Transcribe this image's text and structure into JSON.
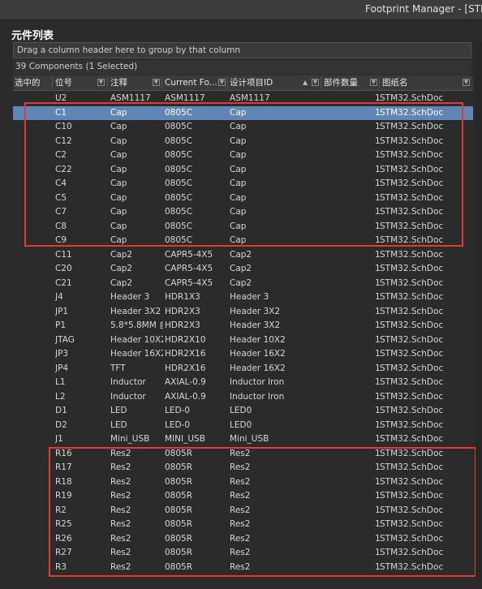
{
  "window": {
    "title": "Footprint Manager - [STM"
  },
  "panel": {
    "title": "元件列表"
  },
  "group_hint": "Drag a column header here to group by that column",
  "count_text": "39 Components (1 Selected)",
  "columns": [
    {
      "label": "选中的"
    },
    {
      "label": "位号"
    },
    {
      "label": "注释"
    },
    {
      "label": "Current Fo..."
    },
    {
      "label": "设计项目ID"
    },
    {
      "label": "部件数量"
    },
    {
      "label": "图纸名"
    }
  ],
  "rows": [
    {
      "designator": "U2",
      "comment": "ASM1117",
      "footprint": "ASM1117",
      "design_id": "ASM1117",
      "count": "1",
      "sheet": "STM32.SchDoc"
    },
    {
      "designator": "C1",
      "comment": "Cap",
      "footprint": "0805C",
      "design_id": "Cap",
      "count": "1",
      "sheet": "STM32.SchDoc"
    },
    {
      "designator": "C10",
      "comment": "Cap",
      "footprint": "0805C",
      "design_id": "Cap",
      "count": "1",
      "sheet": "STM32.SchDoc"
    },
    {
      "designator": "C12",
      "comment": "Cap",
      "footprint": "0805C",
      "design_id": "Cap",
      "count": "1",
      "sheet": "STM32.SchDoc"
    },
    {
      "designator": "C2",
      "comment": "Cap",
      "footprint": "0805C",
      "design_id": "Cap",
      "count": "1",
      "sheet": "STM32.SchDoc"
    },
    {
      "designator": "C22",
      "comment": "Cap",
      "footprint": "0805C",
      "design_id": "Cap",
      "count": "1",
      "sheet": "STM32.SchDoc"
    },
    {
      "designator": "C4",
      "comment": "Cap",
      "footprint": "0805C",
      "design_id": "Cap",
      "count": "1",
      "sheet": "STM32.SchDoc"
    },
    {
      "designator": "C5",
      "comment": "Cap",
      "footprint": "0805C",
      "design_id": "Cap",
      "count": "1",
      "sheet": "STM32.SchDoc"
    },
    {
      "designator": "C7",
      "comment": "Cap",
      "footprint": "0805C",
      "design_id": "Cap",
      "count": "1",
      "sheet": "STM32.SchDoc"
    },
    {
      "designator": "C8",
      "comment": "Cap",
      "footprint": "0805C",
      "design_id": "Cap",
      "count": "1",
      "sheet": "STM32.SchDoc"
    },
    {
      "designator": "C9",
      "comment": "Cap",
      "footprint": "0805C",
      "design_id": "Cap",
      "count": "1",
      "sheet": "STM32.SchDoc"
    },
    {
      "designator": "C11",
      "comment": "Cap2",
      "footprint": "CAPR5-4X5",
      "design_id": "Cap2",
      "count": "1",
      "sheet": "STM32.SchDoc"
    },
    {
      "designator": "C20",
      "comment": "Cap2",
      "footprint": "CAPR5-4X5",
      "design_id": "Cap2",
      "count": "1",
      "sheet": "STM32.SchDoc"
    },
    {
      "designator": "C21",
      "comment": "Cap2",
      "footprint": "CAPR5-4X5",
      "design_id": "Cap2",
      "count": "1",
      "sheet": "STM32.SchDoc"
    },
    {
      "designator": "J4",
      "comment": "Header 3",
      "footprint": "HDR1X3",
      "design_id": "Header 3",
      "count": "1",
      "sheet": "STM32.SchDoc"
    },
    {
      "designator": "JP1",
      "comment": "Header 3X2",
      "footprint": "HDR2X3",
      "design_id": "Header 3X2",
      "count": "1",
      "sheet": "STM32.SchDoc"
    },
    {
      "designator": "P1",
      "comment": "5.8*5.8MM 自",
      "footprint": "HDR2X3",
      "design_id": "Header 3X2",
      "count": "1",
      "sheet": "STM32.SchDoc"
    },
    {
      "designator": "JTAG",
      "comment": "Header 10X2",
      "footprint": "HDR2X10",
      "design_id": "Header 10X2",
      "count": "1",
      "sheet": "STM32.SchDoc"
    },
    {
      "designator": "JP3",
      "comment": "Header 16X2",
      "footprint": "HDR2X16",
      "design_id": "Header 16X2",
      "count": "1",
      "sheet": "STM32.SchDoc"
    },
    {
      "designator": "JP4",
      "comment": "TFT",
      "footprint": "HDR2X16",
      "design_id": "Header 16X2",
      "count": "1",
      "sheet": "STM32.SchDoc"
    },
    {
      "designator": "L1",
      "comment": "Inductor",
      "footprint": "AXIAL-0.9",
      "design_id": "Inductor Iron",
      "count": "1",
      "sheet": "STM32.SchDoc"
    },
    {
      "designator": "L2",
      "comment": "Inductor",
      "footprint": "AXIAL-0.9",
      "design_id": "Inductor Iron",
      "count": "1",
      "sheet": "STM32.SchDoc"
    },
    {
      "designator": "D1",
      "comment": "LED",
      "footprint": "LED-0",
      "design_id": "LED0",
      "count": "1",
      "sheet": "STM32.SchDoc"
    },
    {
      "designator": "D2",
      "comment": "LED",
      "footprint": "LED-0",
      "design_id": "LED0",
      "count": "1",
      "sheet": "STM32.SchDoc"
    },
    {
      "designator": "J1",
      "comment": "Mini_USB",
      "footprint": "MINI_USB",
      "design_id": "Mini_USB",
      "count": "1",
      "sheet": "STM32.SchDoc"
    },
    {
      "designator": "R16",
      "comment": "Res2",
      "footprint": "0805R",
      "design_id": "Res2",
      "count": "1",
      "sheet": "STM32.SchDoc"
    },
    {
      "designator": "R17",
      "comment": "Res2",
      "footprint": "0805R",
      "design_id": "Res2",
      "count": "1",
      "sheet": "STM32.SchDoc"
    },
    {
      "designator": "R18",
      "comment": "Res2",
      "footprint": "0805R",
      "design_id": "Res2",
      "count": "1",
      "sheet": "STM32.SchDoc"
    },
    {
      "designator": "R19",
      "comment": "Res2",
      "footprint": "0805R",
      "design_id": "Res2",
      "count": "1",
      "sheet": "STM32.SchDoc"
    },
    {
      "designator": "R2",
      "comment": "Res2",
      "footprint": "0805R",
      "design_id": "Res2",
      "count": "1",
      "sheet": "STM32.SchDoc"
    },
    {
      "designator": "R25",
      "comment": "Res2",
      "footprint": "0805R",
      "design_id": "Res2",
      "count": "1",
      "sheet": "STM32.SchDoc"
    },
    {
      "designator": "R26",
      "comment": "Res2",
      "footprint": "0805R",
      "design_id": "Res2",
      "count": "1",
      "sheet": "STM32.SchDoc"
    },
    {
      "designator": "R27",
      "comment": "Res2",
      "footprint": "0805R",
      "design_id": "Res2",
      "count": "1",
      "sheet": "STM32.SchDoc"
    },
    {
      "designator": "R3",
      "comment": "Res2",
      "footprint": "0805R",
      "design_id": "Res2",
      "count": "1",
      "sheet": "STM32.SchDoc"
    }
  ],
  "selected_row_index": 1,
  "colors": {
    "selection": "#5f86b4",
    "highlight_box": "#e23a3a"
  },
  "icons": {
    "filter": "filter-icon",
    "sort": "sort-ascending-icon"
  }
}
